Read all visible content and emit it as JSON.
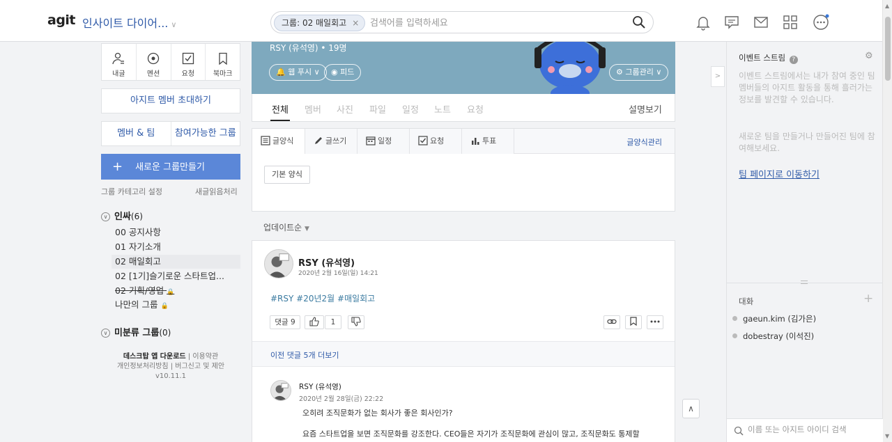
{
  "header": {
    "logo": "agit",
    "org_name": "인사이트 다이어...",
    "search_chip": "그룹: 02 매일회고",
    "search_placeholder": "검색어를 입력하세요",
    "chip_close": "×"
  },
  "left": {
    "quick": [
      {
        "label": "내글",
        "icon": "my-posts-icon"
      },
      {
        "label": "멘션",
        "icon": "mention-icon"
      },
      {
        "label": "요청",
        "icon": "request-check-icon"
      },
      {
        "label": "북마크",
        "icon": "bookmark-icon"
      }
    ],
    "invite": "아지트 멤버 초대하기",
    "members_tab": "멤버 & 팀",
    "joinable_tab": "참여가능한 그룹",
    "new_group_plus": "+",
    "new_group": "새로운 그룹만들기",
    "category_settings": "그룹 카테고리 설정",
    "mark_read": "새글읽음처리",
    "sections": [
      {
        "name": "인싸",
        "count": "(6)",
        "toggle": "∨"
      },
      {
        "name": "미분류 그룹",
        "count": "(0)",
        "toggle": "∨"
      }
    ],
    "groups": [
      {
        "label": "00 공지사항"
      },
      {
        "label": "01 자기소개"
      },
      {
        "label": "02 매일회고"
      },
      {
        "label": "02 [1기]슬기로운 스타트업..."
      },
      {
        "label": "02 기획/영업"
      },
      {
        "label": "나만의 그룹"
      }
    ],
    "footer": {
      "download": "데스크탑 앱 다운로드",
      "terms": "이용약관",
      "privacy": "개인정보처리방침",
      "report": "버그신고 및 제안",
      "version": "v10.11.1"
    }
  },
  "banner": {
    "members_text": "RSY (유석영) • 19명",
    "web_push": "웹 푸시",
    "feed": "피드",
    "group_manage": "그룹관리"
  },
  "tabs": {
    "items": [
      "전체",
      "멤버",
      "사진",
      "파일",
      "일정",
      "노트",
      "요청"
    ],
    "active": "전체",
    "view_desc": "설명보기"
  },
  "composer": {
    "tabs": [
      "글양식",
      "글쓰기",
      "일정",
      "요청",
      "투표"
    ],
    "manage": "글양식관리",
    "basic_form": "기본 양식"
  },
  "feed": {
    "sort": "업데이트순"
  },
  "post": {
    "author": "RSY (유석영)",
    "date": "2020년 2월 16일(일) 14:21",
    "tags": "#RSY #20년2월 #매일회고",
    "comments_label": "댓글 9",
    "like_count": "1",
    "more_comments": "이전 댓글 5개 더보기",
    "comment": {
      "author": "RSY (유석영)",
      "date": "2020년 2월 28일(금) 22:22",
      "line1": "오히려 조직문화가 없는 회사가 좋은 회사인가?",
      "line2": "요즘 스타트업을 보면 조직문화를 강조한다. CEO들은 자기가 조직문화에 관심이 많고, 조직문화도 통제할"
    }
  },
  "right": {
    "event_stream": "이벤트 스트림",
    "event_help": "?",
    "desc1": "이벤트 스트림에서는 내가 참여 중인 팀 멤버들의 아지트 활동을 통해 흘러가는 정보를 발견할 수 있습니다.",
    "desc2": "새로운 팀을 만들거나 만들어진 팀에 참여해보세요.",
    "team_link": "팀 페이지로 이동하기",
    "chat_title": "대화",
    "chat_users": [
      "gaeun.kim (김가은)",
      "dobestray (이석진)"
    ],
    "chat_search_placeholder": "이름 또는 아지트 아이디 검색"
  }
}
